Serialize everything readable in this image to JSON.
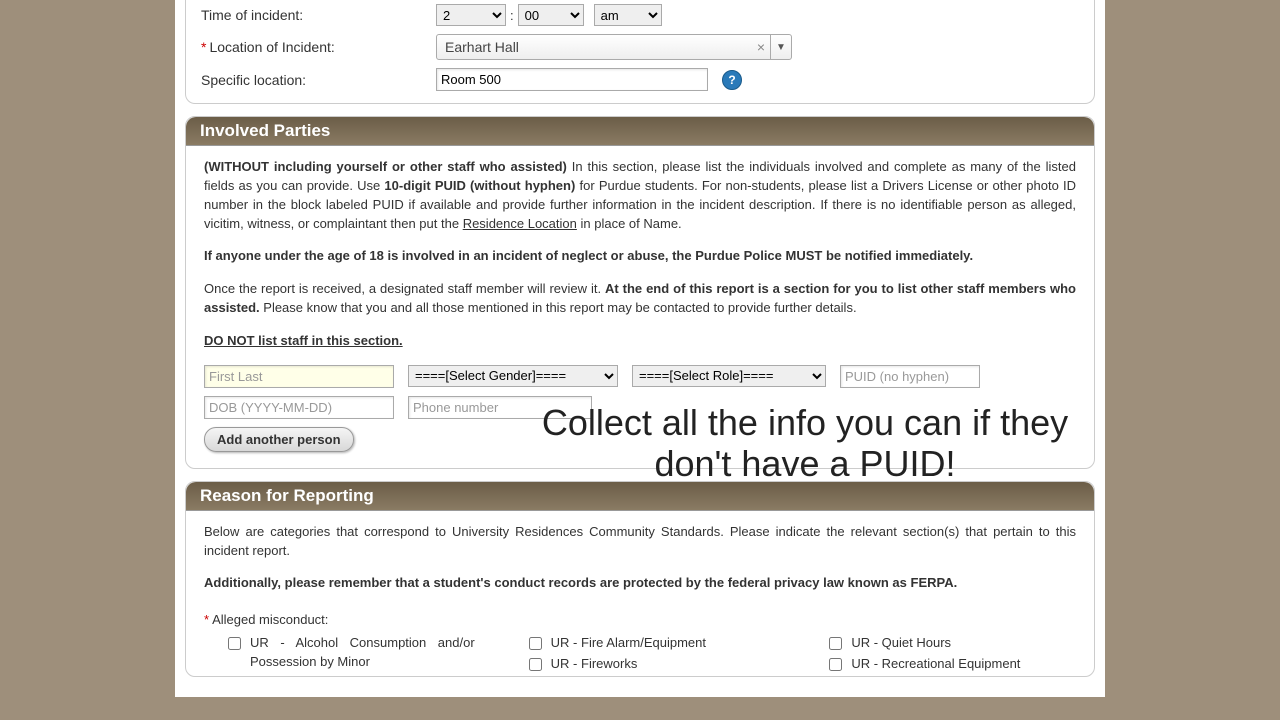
{
  "incident": {
    "time_label": "Time of incident:",
    "hour": "2",
    "minute": "00",
    "ampm": "am",
    "location_label": "Location of Incident:",
    "location_value": "Earhart Hall",
    "specific_label": "Specific location:",
    "specific_value": "Room 500"
  },
  "involved": {
    "header": "Involved Parties",
    "p1_bold": "(WITHOUT including yourself or other staff who assisted)",
    "p1_a": " In this section, please list the individuals involved and complete as many of the listed fields as you can provide. Use ",
    "p1_puid": "10-digit PUID (without hyphen)",
    "p1_b": " for Purdue students. For non-students, please list a Drivers License or other photo ID number in the block labeled PUID if available and provide further information in the incident description. If there is no identifiable person as alleged, vicitim, witness, or complaintant then put the ",
    "p1_res": "Residence Location",
    "p1_c": " in place of Name.",
    "p2": "If anyone under the age of 18 is involved in an incident of neglect or abuse, the Purdue Police MUST be notified immediately.",
    "p3_a": "Once the report is received, a designated staff member will review it. ",
    "p3_b": "At the end of this report is a section for you to list other staff members who assisted.",
    "p3_c": " Please know that you and all those mentioned in this report may be contacted to provide further details.",
    "p4": "DO NOT list staff in this section.",
    "name_ph": "First Last",
    "gender_ph": "====[Select Gender]====",
    "role_ph": "====[Select Role]====",
    "puid_ph": "PUID (no hyphen)",
    "dob_ph": "DOB (YYYY-MM-DD)",
    "phone_ph": "Phone number",
    "add_btn": "Add another person",
    "overlay": "Collect all the info you can if they don't have a PUID!"
  },
  "reason": {
    "header": "Reason for Reporting",
    "p1": "Below are categories that correspond to University Residences Community Standards. Please indicate the relevant section(s) that pertain to this incident report.",
    "p2": "Additionally, please remember that a student's conduct records are protected by the federal privacy law known as FERPA.",
    "alleged_label": "Alleged misconduct:",
    "c1": "UR - Alcohol Consumption and/or Possession by Minor",
    "c2": "UR - Fire Alarm/Equipment",
    "c3": "UR - Fireworks",
    "c4": "UR - Quiet Hours",
    "c5": "UR - Recreational Equipment"
  }
}
